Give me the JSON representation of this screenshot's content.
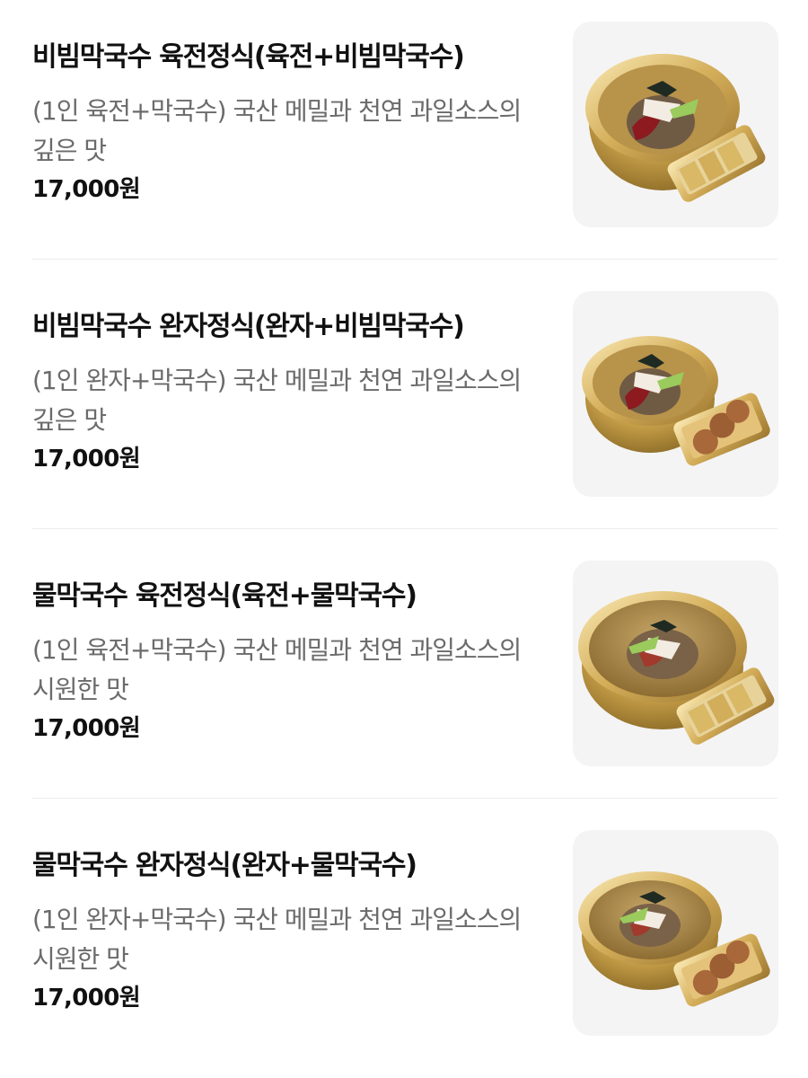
{
  "menu": {
    "items": [
      {
        "title": "비빔막국수 육전정식(육전+비빔막국수)",
        "description": "(1인 육전+막국수) 국산 메밀과 천연 과일소스의 깊은 맛",
        "price": "17,000원",
        "image_alt": "bibim-noodle-with-meat-pancake"
      },
      {
        "title": "비빔막국수 완자정식(완자+비빔막국수)",
        "description": "(1인 완자+막국수) 국산 메밀과 천연 과일소스의 깊은 맛",
        "price": "17,000원",
        "image_alt": "bibim-noodle-with-meatballs"
      },
      {
        "title": "물막국수 육전정식(육전+물막국수)",
        "description": "(1인 육전+막국수) 국산 메밀과 천연 과일소스의 시원한 맛",
        "price": "17,000원",
        "image_alt": "cold-broth-noodle-with-meat-pancake"
      },
      {
        "title": "물막국수 완자정식(완자+물막국수)",
        "description": "(1인 완자+막국수) 국산 메밀과 천연 과일소스의 시원한 맛",
        "price": "17,000원",
        "image_alt": "cold-broth-noodle-with-meatballs"
      }
    ]
  },
  "colors": {
    "title": "#111111",
    "description": "#6b6b6b",
    "thumb_bg": "#f4f4f5",
    "brass": "#c9a14a"
  }
}
